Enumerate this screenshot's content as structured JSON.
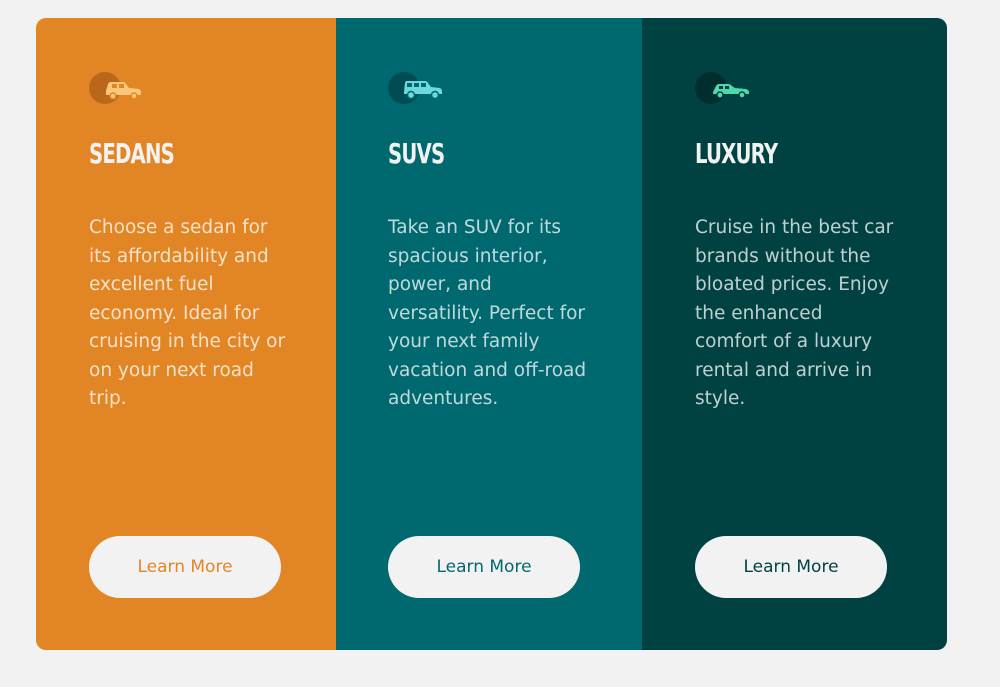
{
  "theme": {
    "background": "#f2f2f2",
    "sedans_color": "#e28625",
    "suvs_color": "#006970",
    "luxury_color": "#004241",
    "button_bg": "#f2f2f2"
  },
  "cards": [
    {
      "id": "sedans",
      "icon": "sedan-car-icon",
      "title": "SEDANS",
      "text": "Choose a sedan for its affordability and excellent fuel economy. Ideal for cruising in the city or on your next road trip.",
      "button_label": "Learn More"
    },
    {
      "id": "suvs",
      "icon": "suv-car-icon",
      "title": "SUVS",
      "text": "Take an SUV for its spacious interior, power, and versatility. Perfect for your next family vacation and off-road adventures.",
      "button_label": "Learn More"
    },
    {
      "id": "luxury",
      "icon": "luxury-car-icon",
      "title": "LUXURY",
      "text": "Cruise in the best car brands without the bloated prices. Enjoy the enhanced comfort of a luxury rental and arrive in style.",
      "button_label": "Learn More"
    }
  ]
}
